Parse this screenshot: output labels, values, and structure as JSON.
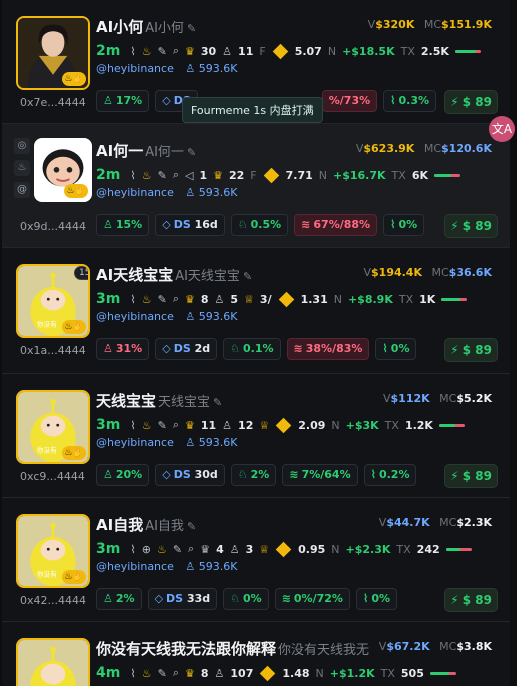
{
  "tooltip": "Fourmeme 1s 内盘打满",
  "translate_icon": "translate-icon",
  "cards": [
    {
      "title": "AI小何",
      "subtitle": "AI小何",
      "v": "$320K",
      "mc": "$151.9K",
      "v_label": "V",
      "mc_label": "MC",
      "mc_color": "gold",
      "age": "2m",
      "holders_top": "30",
      "holders": "11",
      "f": "5.07",
      "n": "+$18.5K",
      "tx": "2.5K",
      "handle": "@heyibinance",
      "followers": "593.6K",
      "addr": "0x7e...4444",
      "p1": "17%",
      "ds": "DS",
      "ds_days": "",
      "p3": "",
      "p4": "%/73%",
      "p5": "0.3%",
      "buy": "$ 89"
    },
    {
      "title": "AI何一",
      "subtitle": "AI何一",
      "v": "$623.9K",
      "mc": "$120.6K",
      "v_label": "V",
      "mc_label": "MC",
      "age": "2m",
      "extra": "1",
      "holders_top": "22",
      "f": "7.71",
      "n": "+$16.7K",
      "tx": "6K",
      "handle": "@heyibinance",
      "followers": "593.6K",
      "addr": "0x9d...4444",
      "p1": "15%",
      "ds": "DS",
      "ds_days": "16d",
      "p3": "0.5%",
      "p4": "67%/88%",
      "p5": "0%",
      "buy": "$ 89"
    },
    {
      "title": "AI天线宝宝",
      "subtitle": "AI天线宝宝",
      "badge": "15",
      "v": "$194.4K",
      "mc": "$36.6K",
      "v_label": "V",
      "mc_label": "MC",
      "age": "3m",
      "holders_top": "8",
      "holders": "5",
      "f": "1.31",
      "n": "+$8.9K",
      "tx": "1K",
      "handle": "@heyibinance",
      "followers": "593.6K",
      "addr": "0x1a...4444",
      "p1": "31%",
      "ds": "DS",
      "ds_days": "2d",
      "p3": "0.1%",
      "p4": "38%/83%",
      "p5": "0%",
      "buy": "$ 89"
    },
    {
      "title": "天线宝宝",
      "subtitle": "天线宝宝",
      "v": "$112K",
      "mc": "$5.2K",
      "v_label": "V",
      "mc_label": "MC",
      "age": "3m",
      "holders_top": "11",
      "holders": "12",
      "f": "2.09",
      "n": "+$3K",
      "tx": "1.2K",
      "handle": "@heyibinance",
      "followers": "593.6K",
      "addr": "0xc9...4444",
      "p1": "20%",
      "ds": "DS",
      "ds_days": "30d",
      "p3": "2%",
      "p4": "7%/64%",
      "p5": "0.2%",
      "buy": "$ 89"
    },
    {
      "title": "AI自我",
      "subtitle": "AI自我",
      "v": "$44.7K",
      "mc": "$2.3K",
      "v_label": "V",
      "mc_label": "MC",
      "age": "3m",
      "holders_top": "4",
      "holders": "3",
      "f": "0.95",
      "n": "+$2.3K",
      "tx": "242",
      "handle": "@heyibinance",
      "followers": "593.6K",
      "addr": "0x42...4444",
      "p1": "2%",
      "ds": "DS",
      "ds_days": "33d",
      "p3": "0%",
      "p4": "0%/72%",
      "p5": "0%",
      "buy": "$ 89"
    },
    {
      "title": "你没有天线我无法跟你解释",
      "subtitle": "你没有天线我无",
      "v": "$67.2K",
      "mc": "$3.8K",
      "v_label": "V",
      "mc_label": "MC",
      "age": "4m",
      "holders_top": "8",
      "holders": "107",
      "f": "1.48",
      "n": "+$1.2K",
      "tx": "505",
      "handle": "",
      "followers": "",
      "addr": "",
      "p1": "",
      "ds": "",
      "ds_days": "",
      "p3": "",
      "p4": "",
      "p5": "",
      "buy": ""
    }
  ]
}
